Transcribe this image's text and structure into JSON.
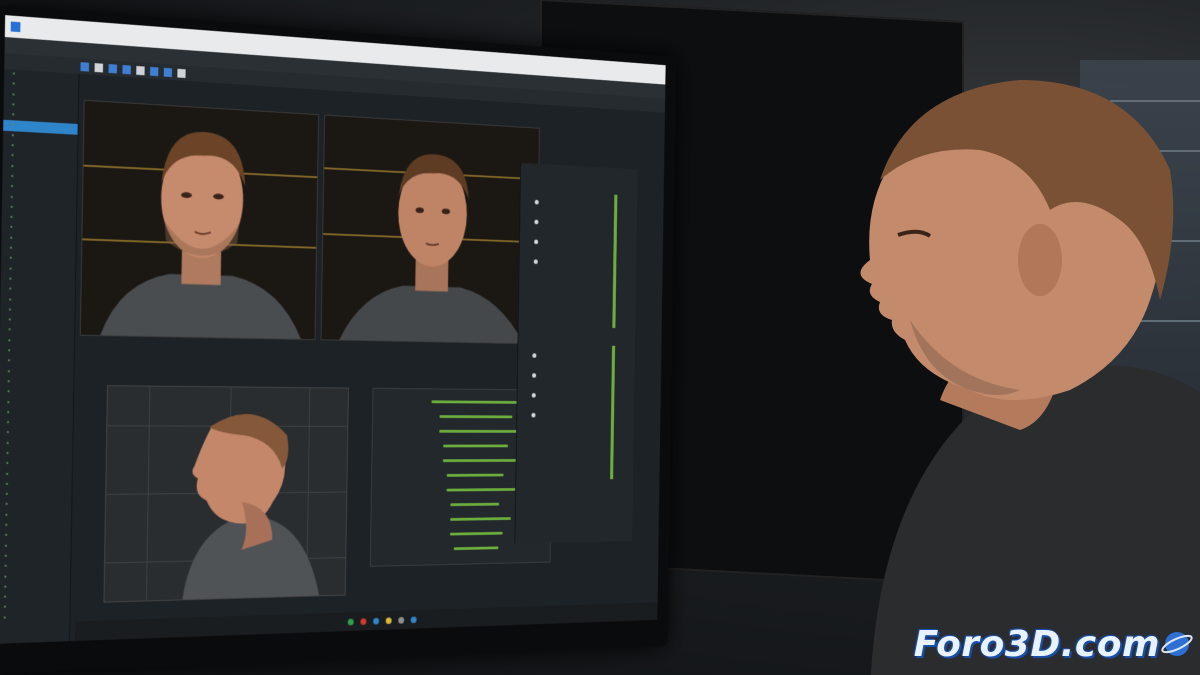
{
  "watermark": {
    "text": "Foro3D.com",
    "color": "#e9f2ff",
    "outline": "#1a4fa8",
    "logo_icon": "globe-orbit-icon"
  },
  "colors": {
    "accent_blue": "#2f85c9",
    "node_green": "#6cae3e",
    "guide_gold": "#9a7b2b"
  }
}
